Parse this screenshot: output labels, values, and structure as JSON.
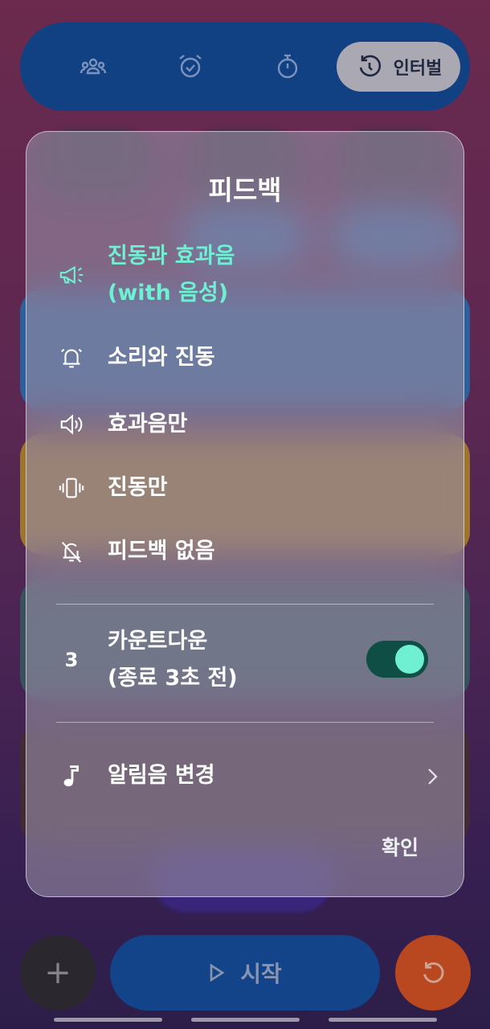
{
  "topbar": {
    "tabs": [
      {
        "icon": "group-icon"
      },
      {
        "icon": "alarm-icon"
      },
      {
        "icon": "stopwatch-icon"
      },
      {
        "icon": "interval-icon",
        "label": "인터벌"
      }
    ]
  },
  "dialog": {
    "title": "피드백",
    "options": [
      {
        "icon": "megaphone-icon",
        "line1": "진동과 효과음",
        "line2": "(with 음성)",
        "selected": true
      },
      {
        "icon": "bell-ring-icon",
        "line1": "소리와 진동",
        "selected": false
      },
      {
        "icon": "speaker-icon",
        "line1": "효과음만",
        "selected": false
      },
      {
        "icon": "vibrate-icon",
        "line1": "진동만",
        "selected": false
      },
      {
        "icon": "bell-off-icon",
        "line1": "피드백 없음",
        "selected": false
      }
    ],
    "countdown": {
      "icon_glyph": "3",
      "line1": "카운트다운",
      "line2": "(종료 3초 전)",
      "enabled": true
    },
    "alarm_sound": {
      "icon": "music-note-icon",
      "label": "알림음 변경"
    },
    "confirm_label": "확인"
  },
  "bottom": {
    "add_glyph": "+",
    "start_label": "시작"
  },
  "colors": {
    "accent": "#6ff0d2",
    "toggle_track": "#0e4e45",
    "topbar": "#0d4b94"
  }
}
